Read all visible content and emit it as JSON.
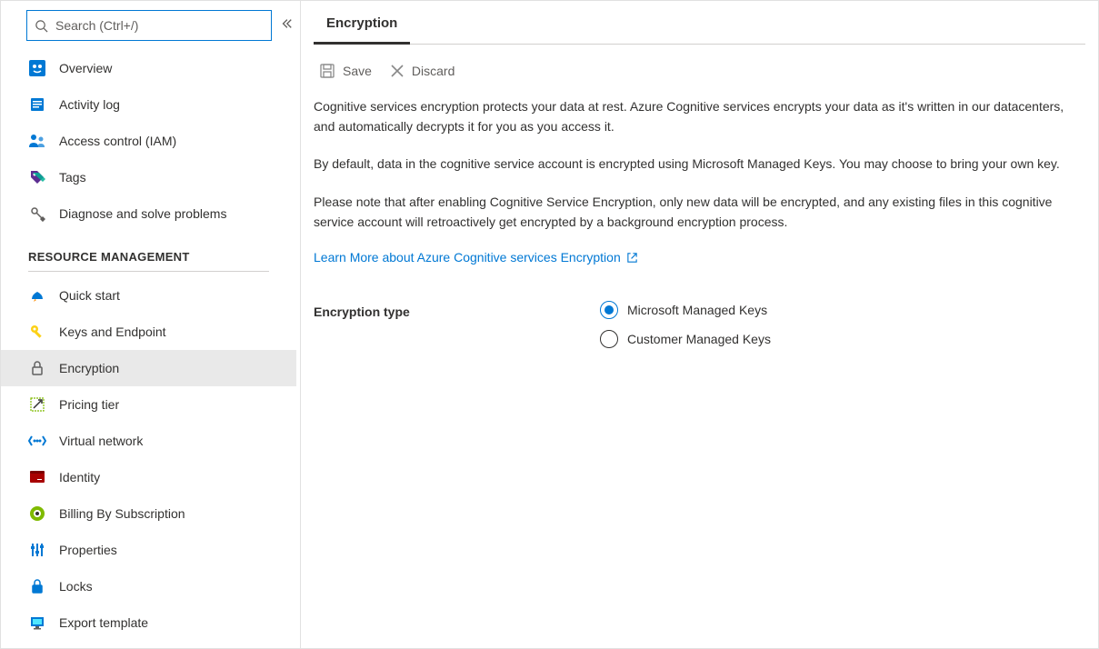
{
  "search": {
    "placeholder": "Search (Ctrl+/)"
  },
  "sidebar": {
    "items_top": [
      {
        "label": "Overview",
        "icon": "overview"
      },
      {
        "label": "Activity log",
        "icon": "activity-log"
      },
      {
        "label": "Access control (IAM)",
        "icon": "access-control"
      },
      {
        "label": "Tags",
        "icon": "tags"
      },
      {
        "label": "Diagnose and solve problems",
        "icon": "diagnose"
      }
    ],
    "section_header": "RESOURCE MANAGEMENT",
    "items_rm": [
      {
        "label": "Quick start",
        "icon": "quick-start"
      },
      {
        "label": "Keys and Endpoint",
        "icon": "keys"
      },
      {
        "label": "Encryption",
        "icon": "encryption",
        "selected": true
      },
      {
        "label": "Pricing tier",
        "icon": "pricing"
      },
      {
        "label": "Virtual network",
        "icon": "vnet"
      },
      {
        "label": "Identity",
        "icon": "identity"
      },
      {
        "label": "Billing By Subscription",
        "icon": "billing"
      },
      {
        "label": "Properties",
        "icon": "properties"
      },
      {
        "label": "Locks",
        "icon": "locks"
      },
      {
        "label": "Export template",
        "icon": "export"
      }
    ]
  },
  "main": {
    "tab": "Encryption",
    "toolbar": {
      "save": "Save",
      "discard": "Discard"
    },
    "para1": "Cognitive services encryption protects your data at rest. Azure Cognitive services encrypts your data as it's written in our datacenters, and automatically decrypts it for you as you access it.",
    "para2": "By default, data in the cognitive service account is encrypted using Microsoft Managed Keys. You may choose to bring your own key.",
    "para3": "Please note that after enabling Cognitive Service Encryption, only new data will be encrypted, and any existing files in this cognitive service account will retroactively get encrypted by a background encryption process.",
    "learn_more": "Learn More about Azure Cognitive services Encryption",
    "form": {
      "label": "Encryption type",
      "options": [
        {
          "label": "Microsoft Managed Keys",
          "checked": true
        },
        {
          "label": "Customer Managed Keys",
          "checked": false
        }
      ]
    }
  }
}
